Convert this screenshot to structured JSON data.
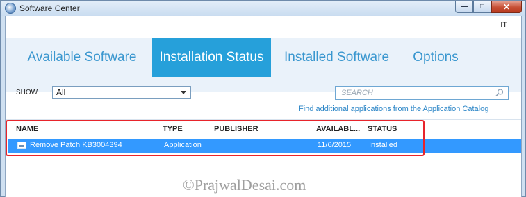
{
  "window": {
    "title": "Software Center",
    "controls": [
      "minimize-icon",
      "maximize-icon",
      "close-icon"
    ]
  },
  "user": {
    "initials": "IT"
  },
  "tabs": [
    {
      "label": "Available Software",
      "active": false
    },
    {
      "label": "Installation Status",
      "active": true
    },
    {
      "label": "Installed Software",
      "active": false
    },
    {
      "label": "Options",
      "active": false
    }
  ],
  "filter": {
    "show_label": "SHOW",
    "selected": "All"
  },
  "search": {
    "placeholder": "SEARCH"
  },
  "catalog_link": "Find additional applications from the Application Catalog",
  "table": {
    "columns": [
      "NAME",
      "TYPE",
      "PUBLISHER",
      "AVAILABL...",
      "STATUS"
    ],
    "rows": [
      {
        "name": "Remove Patch KB3004394",
        "type": "Application",
        "publisher": "",
        "available": "11/6/2015",
        "status": "Installed"
      }
    ]
  },
  "watermark": "©PrajwalDesai.com",
  "colors": {
    "accent": "#26a0da",
    "selection": "#3399ff",
    "highlight_border": "#e8242b",
    "link": "#2c86c7"
  }
}
